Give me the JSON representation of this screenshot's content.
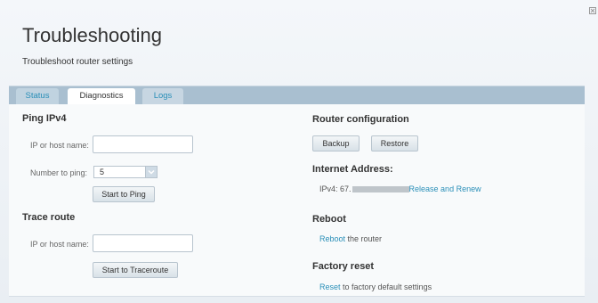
{
  "page": {
    "title": "Troubleshooting",
    "subtitle": "Troubleshoot router settings"
  },
  "tabs": [
    {
      "label": "Status"
    },
    {
      "label": "Diagnostics"
    },
    {
      "label": "Logs"
    }
  ],
  "ping": {
    "heading": "Ping IPv4",
    "host_label": "IP or host name:",
    "host_value": "",
    "count_label": "Number to ping:",
    "count_value": "5",
    "button": "Start to Ping"
  },
  "trace": {
    "heading": "Trace route",
    "host_label": "IP or host name:",
    "host_value": "",
    "button": "Start to Traceroute"
  },
  "router_config": {
    "heading": "Router configuration",
    "backup": "Backup",
    "restore": "Restore"
  },
  "internet": {
    "heading": "Internet Address:",
    "ipv4_prefix": "IPv4: 67.",
    "link": "Release and Renew"
  },
  "reboot": {
    "heading": "Reboot",
    "link": "Reboot",
    "text": " the router"
  },
  "factory": {
    "heading": "Factory reset",
    "link": "Reset",
    "text": " to factory default settings"
  },
  "colors": {
    "accent": "#2a8fb8",
    "tabbar": "#a9bfd0",
    "background": "#eef2f6"
  },
  "icons": {
    "close": "close-icon",
    "dropdown": "chevron-down-icon"
  }
}
